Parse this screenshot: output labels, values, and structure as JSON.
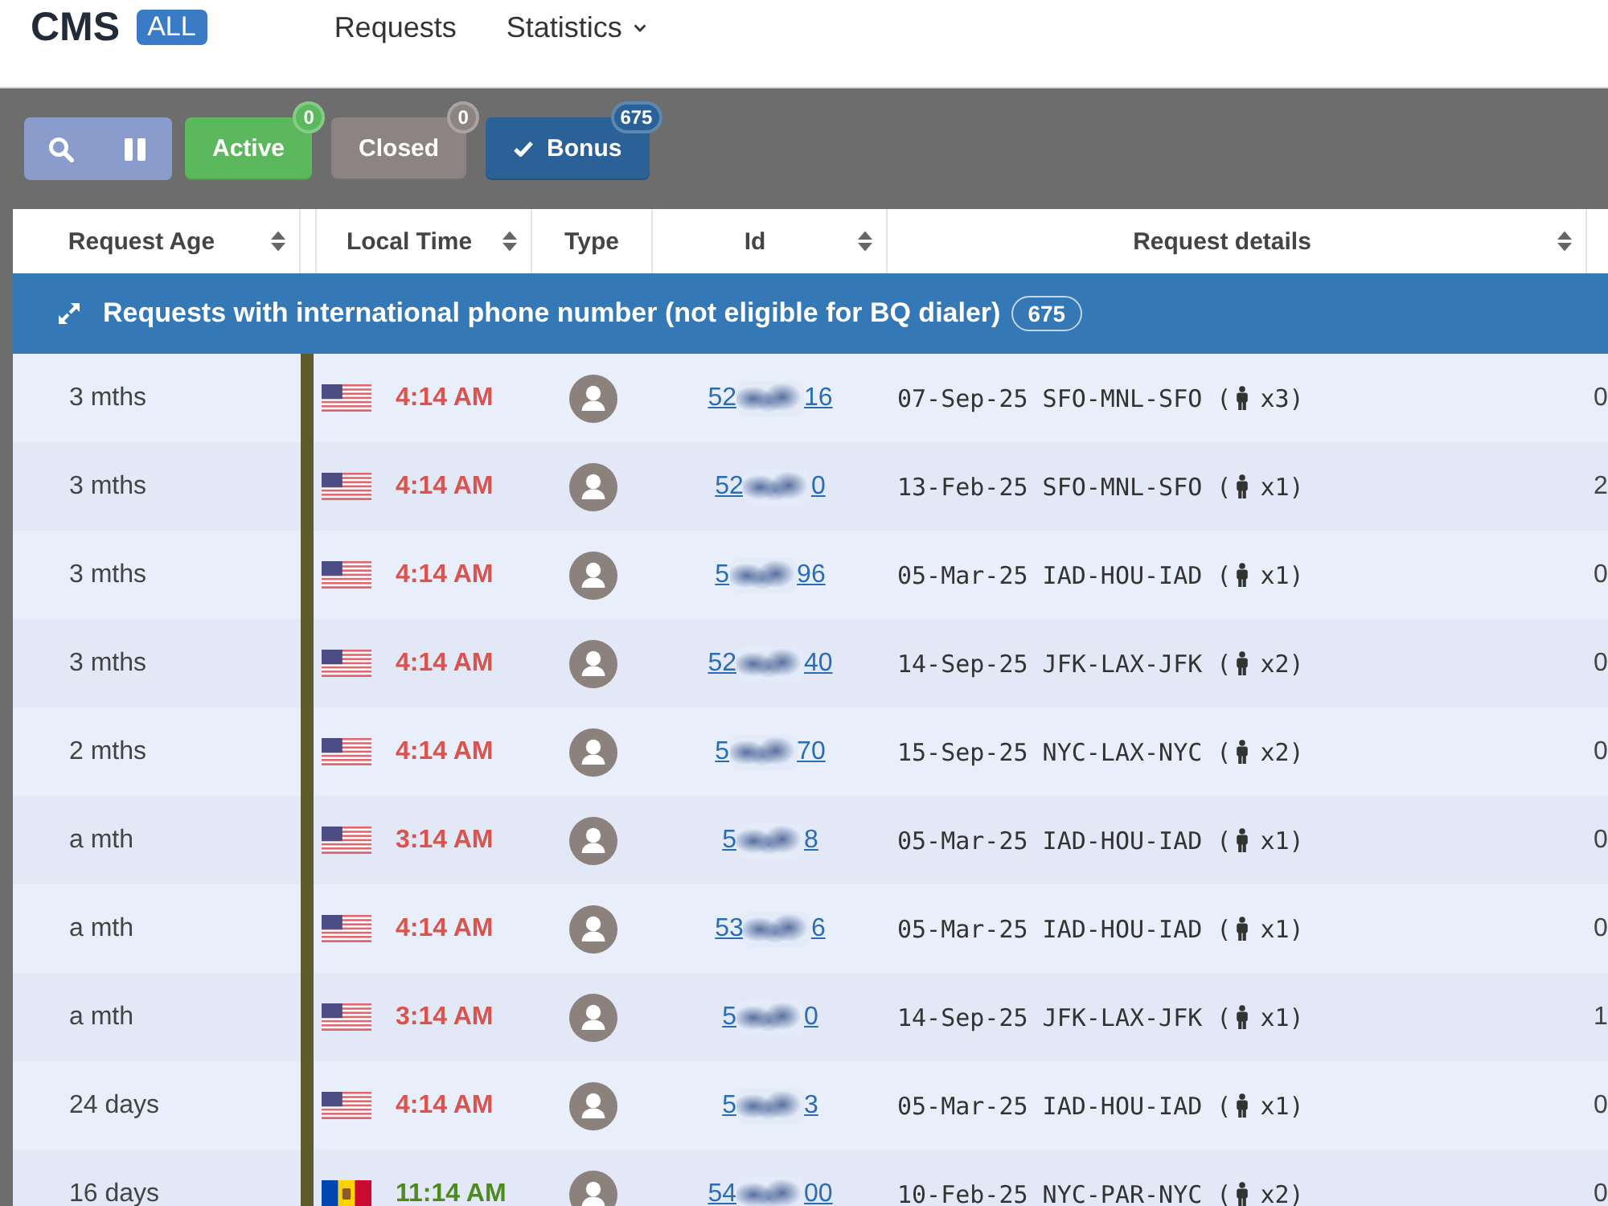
{
  "header": {
    "logo": "CMS",
    "badge": "ALL",
    "nav": [
      {
        "label": "Requests",
        "dropdown": false
      },
      {
        "label": "Statistics",
        "dropdown": true
      }
    ]
  },
  "toolbar": {
    "filters": [
      {
        "label": "Active",
        "count": "0",
        "color": "#5cb85c",
        "checked": false
      },
      {
        "label": "Closed",
        "count": "0",
        "color": "#8c8482",
        "checked": false
      },
      {
        "label": "Bonus",
        "count": "675",
        "color": "#2a6196",
        "checked": true
      }
    ]
  },
  "table": {
    "columns": [
      {
        "label": "Request Age",
        "sortable": true
      },
      {
        "label": "Local Time",
        "sortable": true
      },
      {
        "label": "Type",
        "sortable": false
      },
      {
        "label": "Id",
        "sortable": true
      },
      {
        "label": "Request details",
        "sortable": true
      }
    ],
    "group": {
      "title": "Requests with international phone number (not eligible for BQ dialer)",
      "count": "675"
    },
    "rows": [
      {
        "age": "3 mths",
        "flag": {
          "kind": "us"
        },
        "time": {
          "text": "4:14 AM",
          "color": "#d9534f"
        },
        "id_start": "52",
        "id_end": "16",
        "details": "07-Sep-25 SFO-MNL-SFO (",
        "passengers": "x3)",
        "column_6": "0"
      },
      {
        "age": "3 mths",
        "flag": {
          "kind": "us"
        },
        "time": {
          "text": "4:14 AM",
          "color": "#d9534f"
        },
        "id_start": "52",
        "id_end": "0",
        "details": "13-Feb-25 SFO-MNL-SFO (",
        "passengers": "x1)",
        "column_6": "2"
      },
      {
        "age": "3 mths",
        "flag": {
          "kind": "us"
        },
        "time": {
          "text": "4:14 AM",
          "color": "#d9534f"
        },
        "id_start": "5",
        "id_end": "96",
        "details": "05-Mar-25 IAD-HOU-IAD (",
        "passengers": "x1)",
        "column_6": "0"
      },
      {
        "age": "3 mths",
        "flag": {
          "kind": "us"
        },
        "time": {
          "text": "4:14 AM",
          "color": "#d9534f"
        },
        "id_start": "52",
        "id_end": "40",
        "details": "14-Sep-25 JFK-LAX-JFK (",
        "passengers": "x2)",
        "column_6": "0"
      },
      {
        "age": "2 mths",
        "flag": {
          "kind": "us"
        },
        "time": {
          "text": "4:14 AM",
          "color": "#d9534f"
        },
        "id_start": "5",
        "id_end": "70",
        "details": "15-Sep-25 NYC-LAX-NYC (",
        "passengers": "x2)",
        "column_6": "0"
      },
      {
        "age": "a mth",
        "flag": {
          "kind": "us"
        },
        "time": {
          "text": "3:14 AM",
          "color": "#d9534f"
        },
        "id_start": "5",
        "id_end": "8",
        "details": "05-Mar-25 IAD-HOU-IAD (",
        "passengers": "x1)",
        "column_6": "0"
      },
      {
        "age": "a mth",
        "flag": {
          "kind": "us"
        },
        "time": {
          "text": "4:14 AM",
          "color": "#d9534f"
        },
        "id_start": "53",
        "id_end": "6",
        "details": "05-Mar-25 IAD-HOU-IAD (",
        "passengers": "x1)",
        "column_6": "0"
      },
      {
        "age": "a mth",
        "flag": {
          "kind": "us"
        },
        "time": {
          "text": "3:14 AM",
          "color": "#d9534f"
        },
        "id_start": "5",
        "id_end": "0",
        "details": "14-Sep-25 JFK-LAX-JFK (",
        "passengers": "x1)",
        "column_6": "1"
      },
      {
        "age": "24 days",
        "flag": {
          "kind": "us"
        },
        "time": {
          "text": "4:14 AM",
          "color": "#d9534f"
        },
        "id_start": "5",
        "id_end": "3",
        "details": "05-Mar-25 IAD-HOU-IAD (",
        "passengers": "x1)",
        "column_6": "0"
      },
      {
        "age": "16 days",
        "flag": {
          "kind": "md"
        },
        "time": {
          "text": "11:14 AM",
          "color": "#4e8a1f"
        },
        "id_start": "54",
        "id_end": "00",
        "details": "10-Feb-25 NYC-PAR-NYC (",
        "passengers": "x2)",
        "column_6": "0"
      }
    ]
  }
}
